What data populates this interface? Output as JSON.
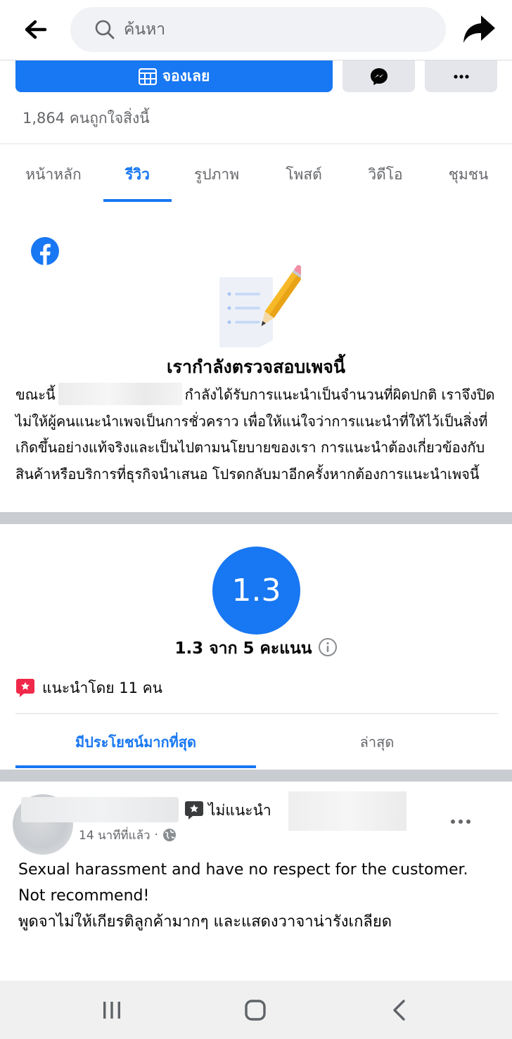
{
  "search": {
    "placeholder": "ค้นหา"
  },
  "actions": {
    "book_label": "จองเลย"
  },
  "page": {
    "likes": "1,864 คนถูกใจสิ่งนี้"
  },
  "tabs": [
    {
      "label": "หน้าหลัก"
    },
    {
      "label": "รีวิว"
    },
    {
      "label": "รูปภาพ"
    },
    {
      "label": "โพสต์"
    },
    {
      "label": "วิดีโอ"
    },
    {
      "label": "ชุมชน"
    }
  ],
  "notice": {
    "title": "เรากำลังตรวจสอบเพจนี้",
    "body_prefix": "ขณะนี้",
    "body_rest": "กำลังได้รับการแนะนำเป็นจำนวนที่ผิดปกติ เราจึงปิดไม่ให้ผู้คนแนะนำเพจเป็นการชั่วคราว เพื่อให้แน่ใจว่าการแนะนำที่ให้ไว้เป็นสิ่งที่เกิดขึ้นอย่างแท้จริงและเป็นไปตามนโยบายของเรา การแนะนำต้องเกี่ยวข้องกับสินค้าหรือบริการที่ธุรกิจนำเสนอ โปรดกลับมาอีกครั้งหากต้องการแนะนำเพจนี้"
  },
  "rating": {
    "score": "1.3",
    "summary": "1.3 จาก 5 คะแนน",
    "recommended_by": "แนะนำโดย 11 คน"
  },
  "review_tabs": {
    "helpful": "มีประโยชน์มากที่สุด",
    "latest": "ล่าสุด"
  },
  "review": {
    "verdict": "ไม่แนะนำ",
    "time": "14 นาทีที่แล้ว",
    "text": "Sexual harassment and have no respect for the customer. Not recommend!\nพูดจาไม่ให้เกียรติลูกค้ามากๆ และแสดงวาจาน่ารังเกลียด"
  },
  "colors": {
    "accent": "#1877f2",
    "divider": "#c9ccd1",
    "secondary_text": "#65676b",
    "recommend_red": "#f02849"
  }
}
